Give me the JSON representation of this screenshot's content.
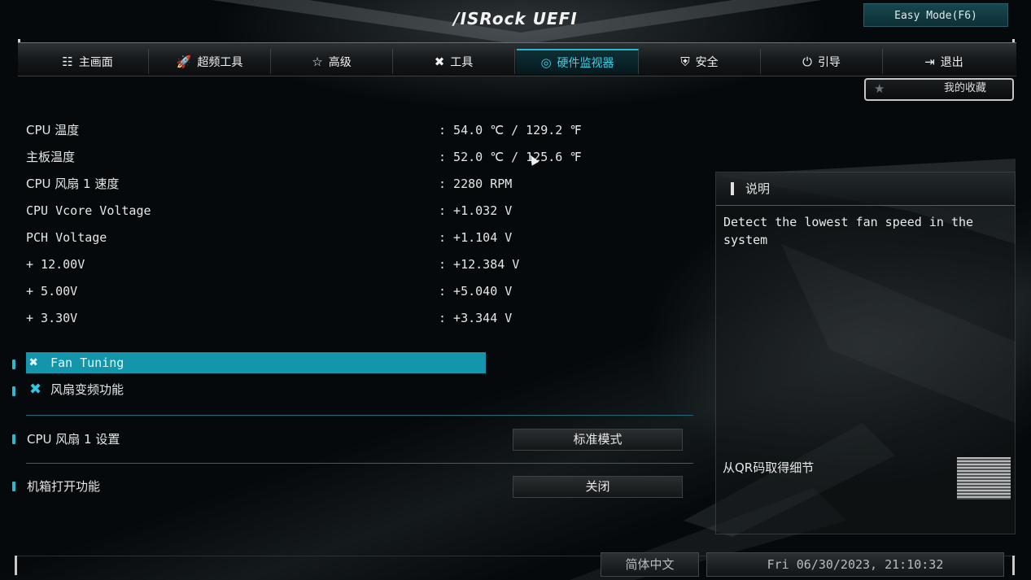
{
  "header": {
    "logo_text": "/ISRock UEFI",
    "easy_mode_label": "Easy Mode(F6)",
    "favorites_label": "我的收藏"
  },
  "nav": {
    "items": [
      {
        "label": "主画面",
        "icon": "list-icon"
      },
      {
        "label": "超频工具",
        "icon": "rocket-icon"
      },
      {
        "label": "高级",
        "icon": "star-icon"
      },
      {
        "label": "工具",
        "icon": "tools-icon"
      },
      {
        "label": "硬件监视器",
        "icon": "monitor-icon",
        "active": true
      },
      {
        "label": "安全",
        "icon": "shield-icon"
      },
      {
        "label": "引导",
        "icon": "power-icon"
      },
      {
        "label": "退出",
        "icon": "exit-icon"
      }
    ],
    "accent_color": "#35d2ea"
  },
  "readings": [
    {
      "label": "CPU 温度",
      "value": ": 54.0 ℃ / 129.2 ℉"
    },
    {
      "label": "主板温度",
      "value": ": 52.0 ℃ / 125.6 ℉"
    },
    {
      "label": "CPU 风扇 1 速度",
      "value": ": 2280 RPM"
    },
    {
      "label": "CPU Vcore Voltage",
      "value": ": +1.032 V"
    },
    {
      "label": "PCH Voltage",
      "value": ": +1.104 V"
    },
    {
      "label": "+ 12.00V",
      "value": ": +12.384 V"
    },
    {
      "label": "+ 5.00V",
      "value": ": +5.040 V"
    },
    {
      "label": "+ 3.30V",
      "value": ": +3.344 V"
    }
  ],
  "menu": {
    "fan_tuning": "Fan Tuning",
    "fan_function": "风扇变频功能"
  },
  "settings": [
    {
      "label": "CPU 风扇 1 设置",
      "value": "标准模式"
    },
    {
      "label": "机箱打开功能",
      "value": "关闭"
    }
  ],
  "description": {
    "title": "说明",
    "text": "Detect the lowest fan speed in the system",
    "qr_label": "从QR码取得细节"
  },
  "footer": {
    "language": "简体中文",
    "datetime": "Fri 06/30/2023, 21:10:32"
  }
}
